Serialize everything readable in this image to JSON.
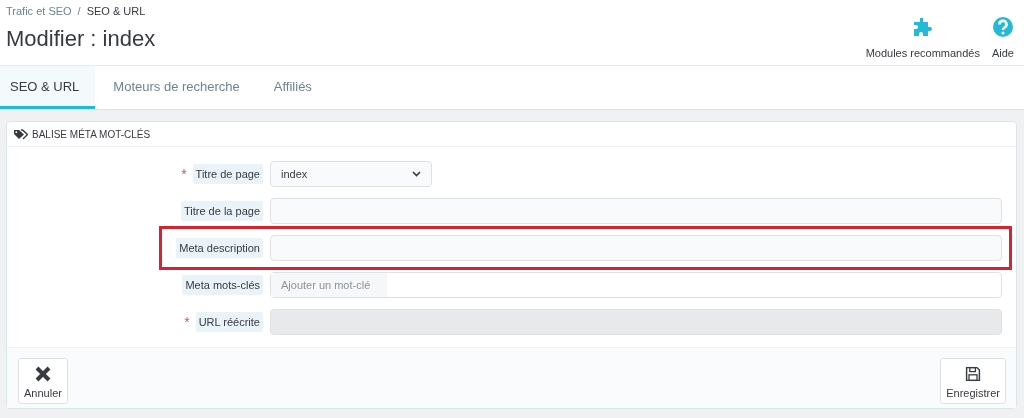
{
  "breadcrumb": {
    "items": [
      "Trafic et SEO",
      "SEO & URL"
    ],
    "separator": "/"
  },
  "page_title": "Modifier : index",
  "toolbar": [
    {
      "label": "Modules recommandés"
    },
    {
      "label": "Aide"
    }
  ],
  "tabs": [
    {
      "label": "SEO & URL",
      "selected": true
    },
    {
      "label": "Moteurs de recherche",
      "selected": false
    },
    {
      "label": "Affiliés",
      "selected": false
    }
  ],
  "panel": {
    "heading": "BALISE MÉTA MOT-CLÉS",
    "required_mark": "*",
    "fields": [
      {
        "label": "Titre de page",
        "required": true,
        "kind": "select",
        "value": "index",
        "highlighted": false
      },
      {
        "label": "Titre de la page",
        "required": false,
        "kind": "text",
        "highlighted": false
      },
      {
        "label": "Meta description",
        "required": false,
        "kind": "text",
        "highlighted": true
      },
      {
        "label": "Meta mots-clés",
        "required": false,
        "kind": "tags",
        "placeholder": "Ajouter un mot-clé",
        "highlighted": false
      },
      {
        "label": "URL réécrite",
        "required": true,
        "kind": "disabled",
        "highlighted": false
      }
    ],
    "buttons": [
      {
        "label": "Annuler"
      },
      {
        "label": "Enregistrer"
      }
    ]
  }
}
